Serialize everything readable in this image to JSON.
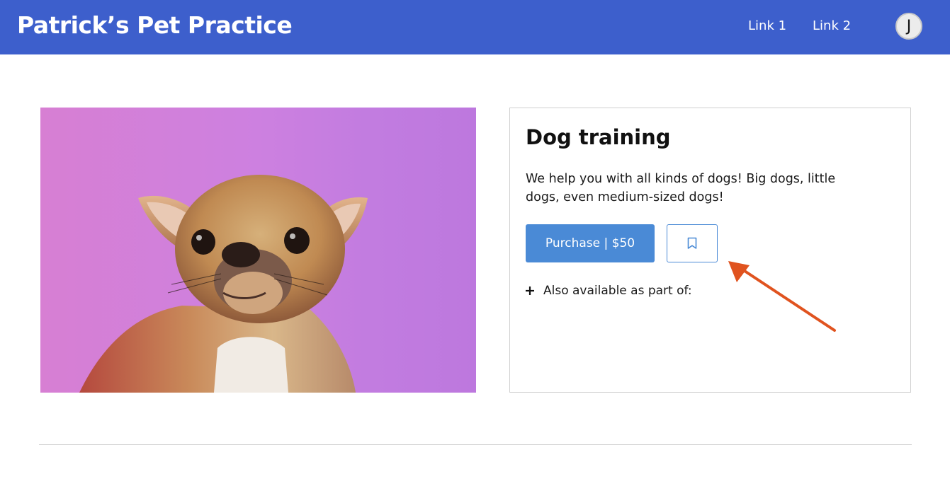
{
  "header": {
    "brand": "Patrick’s Pet Practice",
    "links": [
      "Link 1",
      "Link 2"
    ],
    "avatar_initial": "J"
  },
  "product": {
    "title": "Dog training",
    "description": "We help you with all kinds of dogs! Big dogs, little dogs, even medium-sized dogs!",
    "purchase_label": "Purchase | $50",
    "bookmark_icon": "bookmark-icon",
    "also_available": "Also available as part of:"
  },
  "colors": {
    "header_bg": "#3d5fcc",
    "primary": "#4a8ad6",
    "annotation_arrow": "#e0531f"
  }
}
